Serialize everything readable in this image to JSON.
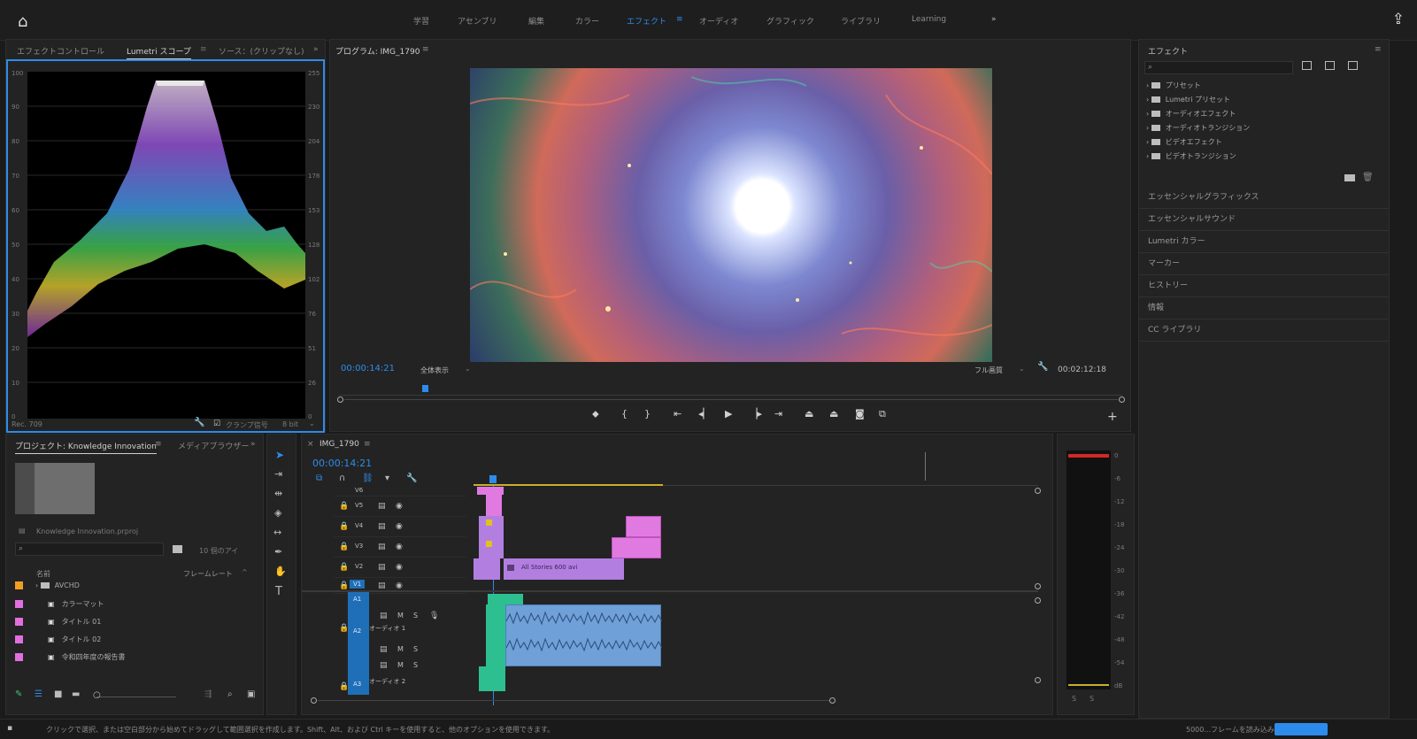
{
  "workspaces": {
    "items": [
      "学習",
      "アセンブリ",
      "編集",
      "カラー",
      "エフェクト",
      "オーディオ",
      "グラフィック",
      "ライブラリ",
      "Learning"
    ],
    "active_index": 4
  },
  "left_top": {
    "tabs": [
      "エフェクトコントロール",
      "Lumetri スコープ",
      "ソース：(クリップなし)"
    ],
    "active_tab": 1,
    "footer_left": "Rec. 709",
    "footer_right": "クランプ信号",
    "footer_bits": "8 bit",
    "scale_left": [
      "100",
      "90",
      "80",
      "70",
      "60",
      "50",
      "40",
      "30",
      "20",
      "10",
      "0"
    ],
    "scale_right": [
      "255",
      "230",
      "204",
      "178",
      "153",
      "128",
      "102",
      "76",
      "51",
      "26",
      "0"
    ]
  },
  "program": {
    "title": "プログラム: IMG_1790",
    "timecode": "00:00:14:21",
    "fit": "全体表示",
    "quality": "フル画質",
    "duration": "00:02:12:18"
  },
  "effects_panel": {
    "title": "エフェクト",
    "search_placeholder": "",
    "tree": [
      {
        "label": "プリセット"
      },
      {
        "label": "Lumetri プリセット"
      },
      {
        "label": "オーディオエフェクト"
      },
      {
        "label": "オーディオトランジション"
      },
      {
        "label": "ビデオエフェクト"
      },
      {
        "label": "ビデオトランジション"
      }
    ],
    "sections": [
      "エッセンシャルグラフィックス",
      "エッセンシャルサウンド",
      "Lumetri カラー",
      "マーカー",
      "ヒストリー",
      "情報",
      "CC ライブラリ"
    ]
  },
  "project": {
    "tabs": [
      "プロジェクト: Knowledge Innovation",
      "メディアブラウザー"
    ],
    "filename": "Knowledge Innovation.prproj",
    "item_count": "10 個のアイ",
    "col_name": "名前",
    "col_rate": "フレームレート",
    "items": [
      {
        "name": "AVCHD",
        "color": "#f0a020"
      },
      {
        "name": "カラーマット",
        "color": "#e070e0"
      },
      {
        "name": "タイトル 01",
        "color": "#e070e0"
      },
      {
        "name": "タイトル 02",
        "color": "#e070e0"
      },
      {
        "name": "令和四年度の報告書",
        "color": "#e070e0"
      }
    ]
  },
  "timeline": {
    "title": "IMG_1790",
    "timecode": "00:00:14:21",
    "video_tracks": [
      "V6",
      "V5",
      "V4",
      "V3",
      "V2",
      "V1"
    ],
    "audio_tracks": [
      "A1",
      "A2",
      "A3"
    ],
    "audio_names": [
      "オーディオ 1",
      "オーディオ 2"
    ],
    "clip_label": "All Stories 600 avi"
  },
  "meter": {
    "scale": [
      "0",
      "-6",
      "-12",
      "-18",
      "-24",
      "-30",
      "-36",
      "-42",
      "-48",
      "-54",
      "dB"
    ]
  },
  "status": {
    "message": "クリックで選択、または空白部分から始めてドラッグして範囲選択を作成します。Shift、Alt、および Ctrl キーを使用すると、他のオプションを使用できます。",
    "right": "5000...フレームを読み込み中"
  }
}
